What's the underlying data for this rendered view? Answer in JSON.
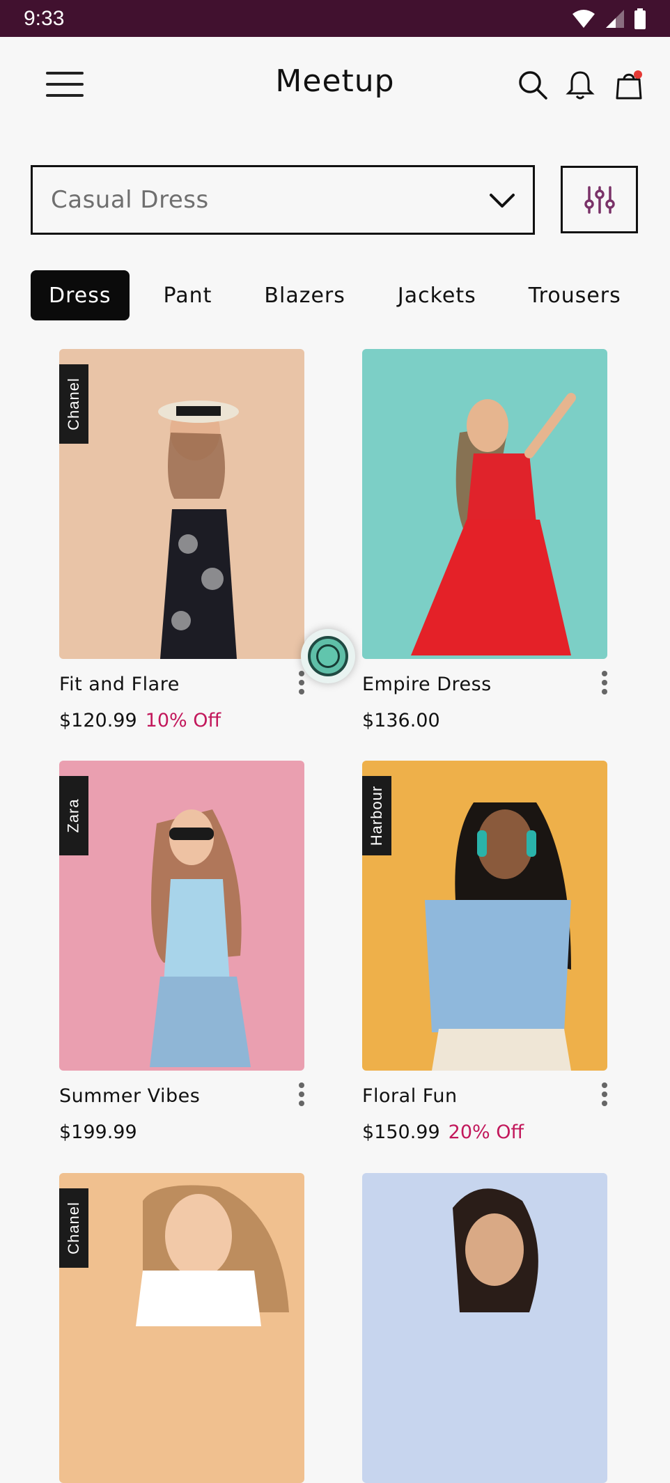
{
  "status_bar": {
    "time": "9:33"
  },
  "header": {
    "title": "Meetup"
  },
  "search": {
    "selected": "Casual Dress"
  },
  "categories": [
    {
      "label": "Dress",
      "active": true
    },
    {
      "label": "Pant",
      "active": false
    },
    {
      "label": "Blazers",
      "active": false
    },
    {
      "label": "Jackets",
      "active": false
    },
    {
      "label": "Trousers",
      "active": false
    }
  ],
  "products": [
    {
      "name": "Fit and Flare",
      "price": "$120.99",
      "discount": "10% Off",
      "brand": "Chanel",
      "image_color": "#e9c4a7"
    },
    {
      "name": "Empire Dress",
      "price": "$136.00",
      "discount": "",
      "brand": "",
      "image_color": "#7ccfc6"
    },
    {
      "name": "Summer Vibes",
      "price": "$199.99",
      "discount": "",
      "brand": "Zara",
      "image_color": "#ea9fb0"
    },
    {
      "name": "Floral Fun",
      "price": "$150.99",
      "discount": "20% Off",
      "brand": "Harbour",
      "image_color": "#eeb04a"
    },
    {
      "name": "",
      "price": "",
      "discount": "",
      "brand": "Chanel",
      "image_color": "#f0c08f"
    },
    {
      "name": "",
      "price": "",
      "discount": "",
      "brand": "",
      "image_color": "#c7d5ee"
    }
  ],
  "colors": {
    "status_bar": "#41112f",
    "accent": "#7a3268",
    "discount": "#c2185b",
    "cart_badge": "#e53935"
  },
  "icons": [
    "menu-icon",
    "search-icon",
    "bell-icon",
    "bag-icon",
    "chevron-down-icon",
    "sliders-icon",
    "more-vert-icon",
    "wifi-icon",
    "signal-icon",
    "battery-icon"
  ]
}
